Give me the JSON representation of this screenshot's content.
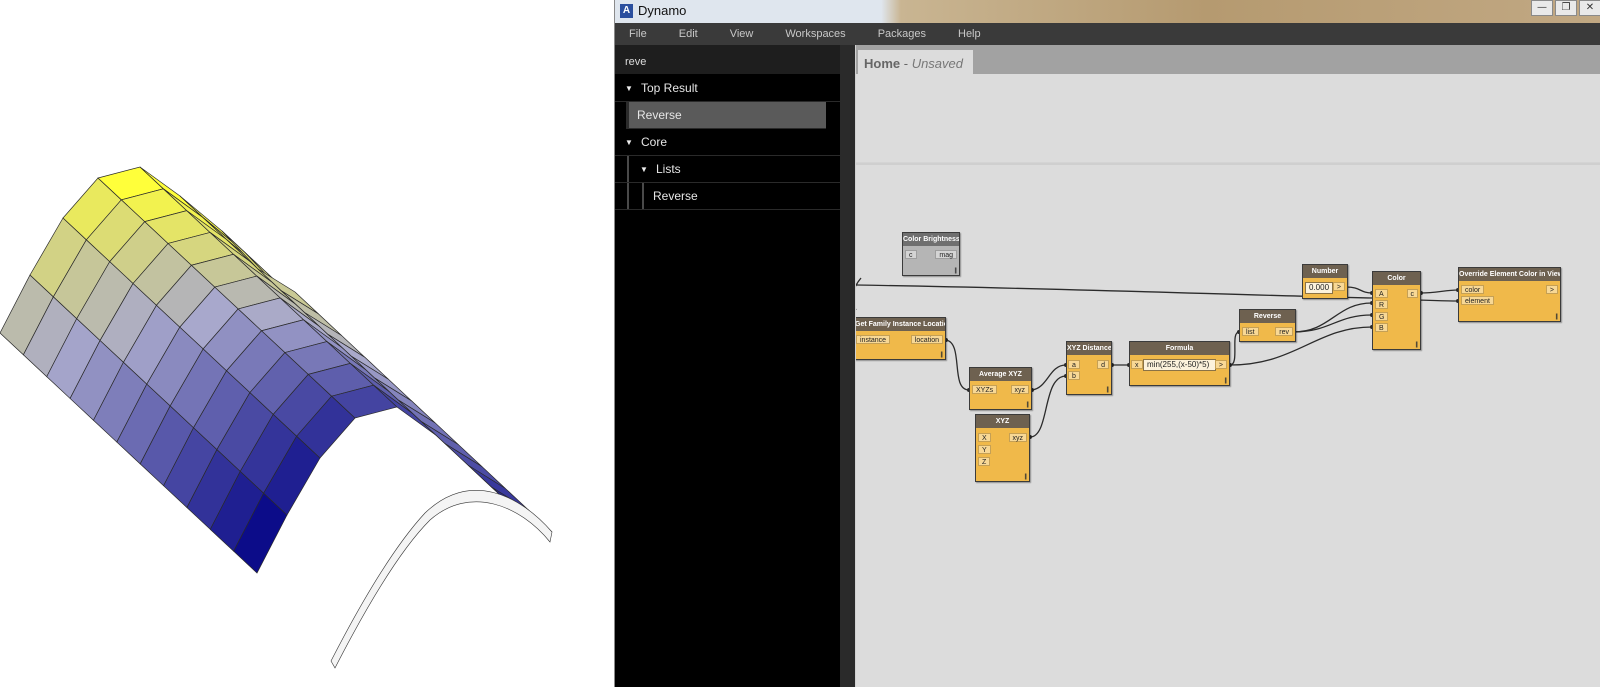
{
  "app": {
    "title": "Dynamo",
    "logo_letter": "A",
    "window_buttons": [
      "—",
      "❐",
      "✕"
    ]
  },
  "menu": [
    "File",
    "Edit",
    "View",
    "Workspaces",
    "Packages",
    "Help"
  ],
  "library": {
    "search_query": "reve",
    "sections": {
      "top_result": {
        "label": "Top Result",
        "items": [
          "Reverse"
        ]
      },
      "core": {
        "label": "Core",
        "subsections": {
          "lists": {
            "label": "Lists",
            "items": [
              "Reverse"
            ]
          }
        }
      }
    }
  },
  "workspace": {
    "tab_name": "Home",
    "tab_status": "Unsaved",
    "tab_separator": " - "
  },
  "nodes": {
    "color_brightness": {
      "title": "Color Brightness",
      "inputs": [
        "c"
      ],
      "outputs": [
        "mag"
      ],
      "state": "disabled"
    },
    "get_family_instance_location": {
      "title": "Get Family Instance Location",
      "inputs": [
        "instance"
      ],
      "outputs": [
        "location"
      ]
    },
    "average_xyz": {
      "title": "Average XYZ",
      "inputs": [
        "XYZs"
      ],
      "outputs": [
        "xyz"
      ]
    },
    "xyz": {
      "title": "XYZ",
      "inputs": [
        "X",
        "Y",
        "Z"
      ],
      "outputs": [
        "xyz"
      ]
    },
    "xyz_distance": {
      "title": "XYZ Distance",
      "inputs": [
        "a",
        "b"
      ],
      "outputs": [
        "d"
      ]
    },
    "formula": {
      "title": "Formula",
      "inputs": [
        "x"
      ],
      "outputs": [
        ">"
      ],
      "expression": "min(255,(x-50)*5)"
    },
    "reverse": {
      "title": "Reverse",
      "inputs": [
        "list"
      ],
      "outputs": [
        "rev"
      ]
    },
    "number": {
      "title": "Number",
      "outputs": [
        ">"
      ],
      "value": "0.000"
    },
    "color": {
      "title": "Color",
      "inputs": [
        "A",
        "R",
        "G",
        "B"
      ],
      "outputs": [
        "c"
      ]
    },
    "override_color": {
      "title": "Override Element Color in View",
      "inputs": [
        "color",
        "element"
      ],
      "outputs": [
        ">"
      ]
    }
  },
  "grip_glyph": "|||",
  "surface": {
    "type": "curved-mesh",
    "gradient_low_color": "#0a0a88",
    "gradient_mid_color": "#a8a8cc",
    "gradient_high_color": "#ffff3a",
    "edge_color": "#2a2a2a"
  }
}
